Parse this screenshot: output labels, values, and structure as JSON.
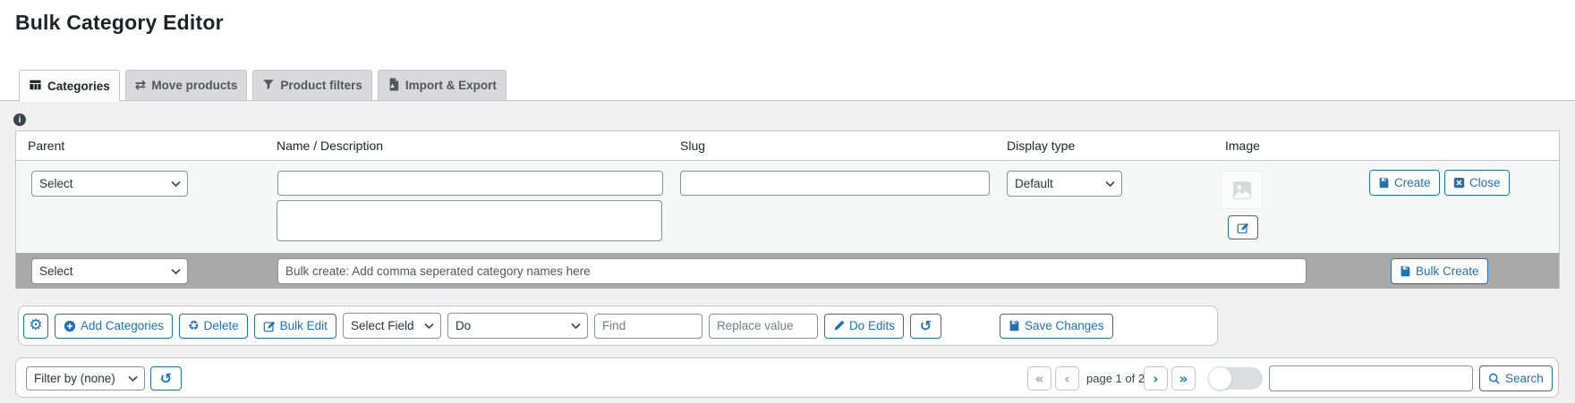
{
  "title": "Bulk Category Editor",
  "tabs": [
    {
      "label": "Categories",
      "icon": "table-icon",
      "active": true
    },
    {
      "label": "Move products",
      "icon": "move-icon",
      "active": false
    },
    {
      "label": "Product filters",
      "icon": "funnel-icon",
      "active": false
    },
    {
      "label": "Import & Export",
      "icon": "import-export-icon",
      "active": false
    }
  ],
  "info": {
    "glyph": "i"
  },
  "table": {
    "headers": {
      "parent": "Parent",
      "name": "Name / Description",
      "slug": "Slug",
      "display": "Display type",
      "image": "Image"
    },
    "row": {
      "parent_selected": "Select",
      "name_value": "",
      "description_value": "",
      "slug_value": "",
      "display_selected": "Default",
      "create_label": "Create",
      "close_label": "Close"
    },
    "bulk_row": {
      "parent_selected": "Select",
      "input_placeholder": "Bulk create: Add comma seperated category names here",
      "button_label": "Bulk Create"
    }
  },
  "toolbar": {
    "add_categories_label": "Add Categories",
    "delete_label": "Delete",
    "bulk_edit_label": "Bulk Edit",
    "select_field_selected": "Select Field",
    "do_selected": "Do",
    "find_placeholder": "Find",
    "replace_placeholder": "Replace value",
    "do_edits_label": "Do Edits",
    "save_changes_label": "Save Changes"
  },
  "footer": {
    "filter_selected": "Filter by (none)",
    "page_text": "page 1 of 2",
    "search_value": "",
    "search_label": "Search"
  },
  "icons": {
    "gear": "⚙",
    "recycle": "♻",
    "undo": "↺",
    "move": "⇄",
    "first": "«",
    "prev": "‹",
    "next": "›",
    "last": "»"
  },
  "colors": {
    "accent": "#2271b1",
    "panel_border": "#c3c4c7",
    "input_border": "#8c8f94",
    "bulk_row_bg": "#a9a9a9",
    "row_bg": "#f6f7f7",
    "page_bg": "#f0f0f1",
    "header_bg": "#ffffff",
    "tab_inactive_bg": "#d9d9db"
  }
}
